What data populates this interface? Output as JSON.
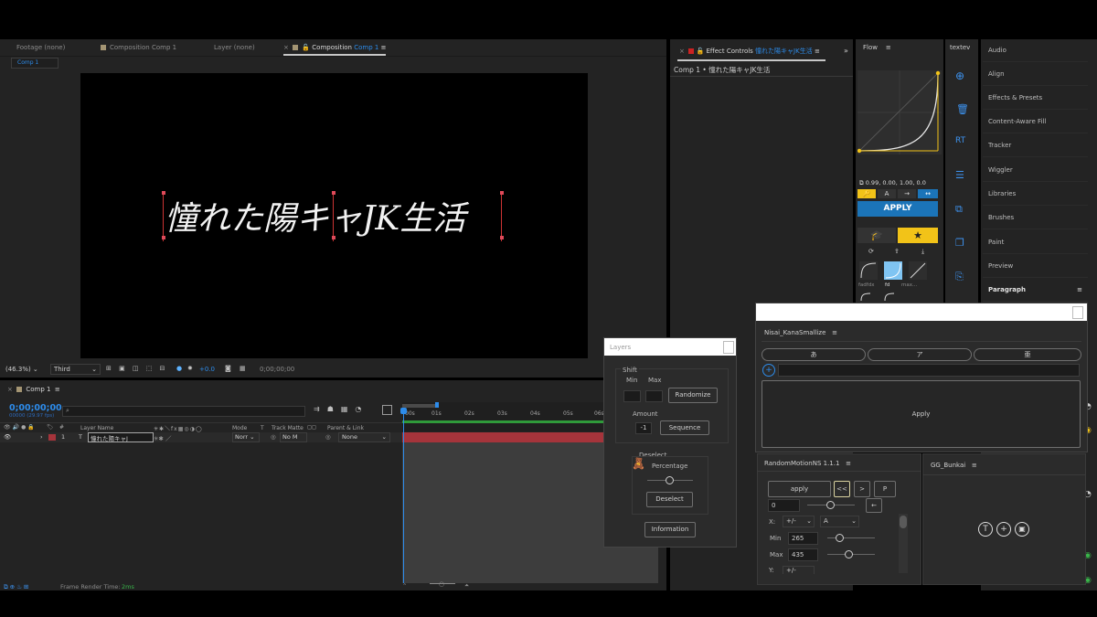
{
  "colors": {
    "accent_blue": "#2d8ceb",
    "apply_blue": "#1b74b8",
    "yellow": "#f2c318",
    "timeline_red": "#a5343b",
    "bg": "#232323"
  },
  "tabs": {
    "footage": "Footage",
    "footage_val": "(none)",
    "comp_inactive": "Composition",
    "comp_inactive_name": "Comp 1",
    "layer": "Layer",
    "layer_val": "(none)",
    "comp_active": "Composition",
    "comp_active_name": "Comp 1",
    "comp_subtab": "Comp 1"
  },
  "viewer": {
    "title_text": "憧れた陽キャJK生活",
    "zoom": "(46.3%)",
    "resolution": "Third",
    "exposure": "+0.0",
    "timecode": "0;00;00;00"
  },
  "effect_controls": {
    "label": "Effect Controls",
    "comp_name": "憧れた陽キャJK生活",
    "path": "Comp 1 • 憧れた陽キャJK生活"
  },
  "flow": {
    "title": "Flow",
    "values": "0.99, 0.00, 1.00, 0.0",
    "apply": "APPLY",
    "preset_labels": [
      "fadfdx",
      "fd",
      "max..."
    ]
  },
  "textev_tab": "textev",
  "right_panels": {
    "items": [
      "Audio",
      "Align",
      "Effects & Presets",
      "Content-Aware Fill",
      "Tracker",
      "Wiggler",
      "Libraries",
      "Brushes",
      "Paint",
      "Preview",
      "Paragraph"
    ]
  },
  "timeline": {
    "tab": "Comp 1",
    "timecode": "0;00;00;00",
    "timecode_sub": "00000 (29.97 fps)",
    "search_placeholder": "",
    "columns": {
      "layer_name": "Layer Name",
      "mode": "Mode",
      "t": "T",
      "track_matte": "Track Matte",
      "parent": "Parent & Link"
    },
    "ruler": [
      "00s",
      "01s",
      "02s",
      "03s",
      "04s",
      "05s",
      "06s"
    ],
    "layer": {
      "num": "1",
      "type": "T",
      "name": "憧れた陽キャJ",
      "mode": "Norr",
      "matte": "No M",
      "parent": "None"
    },
    "render_time_label": "Frame Render Time:",
    "render_time_val": "2ms"
  },
  "layers_panel": {
    "title": "Layers",
    "shift": "Shift",
    "min": "Min",
    "max": "Max",
    "randomize": "Randomize",
    "amount": "Amount",
    "amount_val": "-1",
    "sequence": "Sequence",
    "deselect_group": "Deselect",
    "percentage": "Percentage",
    "deselect_btn": "Deselect",
    "information": "Information"
  },
  "kana_panel": {
    "title": "Nisai_KanaSmallize",
    "btn_hira": "あ",
    "btn_kata": "ア",
    "btn_kanji": "亜",
    "add": "+",
    "apply": "Apply"
  },
  "random_motion": {
    "title": "RandomMotionNS 1.1.1",
    "apply": "apply",
    "prev": "<<",
    "next": ">",
    "p": "P",
    "value": "0",
    "back": "←",
    "x_label": "X:",
    "sign_opt": "+/-",
    "axis_opt": "A",
    "min_label": "Min",
    "min_val": "265",
    "max_label": "Max",
    "max_val": "435",
    "y_label": "Y:",
    "y_opt": "+/-"
  },
  "bunkai": {
    "title": "GG_Bunkai",
    "icons": [
      "T",
      "+",
      "▣"
    ]
  }
}
